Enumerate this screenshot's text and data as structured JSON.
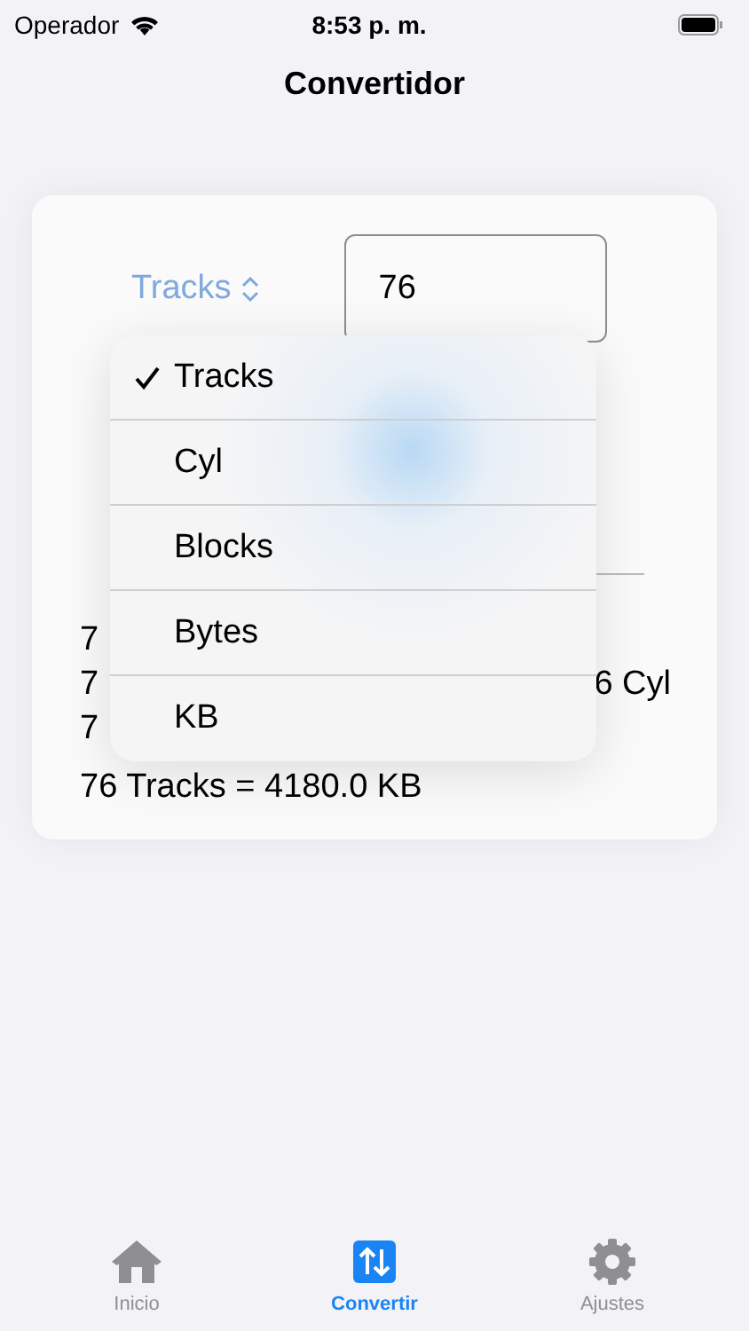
{
  "status_bar": {
    "carrier": "Operador",
    "time": "8:53 p. m."
  },
  "title": "Convertidor",
  "converter": {
    "unit_button": "Tracks",
    "value": "76",
    "results": [
      {
        "text": "7"
      },
      {
        "text": "7",
        "trailing": "6 Cyl"
      },
      {
        "text": "7"
      },
      {
        "text": "76 Tracks = 4180.0 KB"
      }
    ]
  },
  "menu": {
    "items": [
      {
        "label": "Tracks",
        "selected": true
      },
      {
        "label": "Cyl",
        "selected": false
      },
      {
        "label": "Blocks",
        "selected": false
      },
      {
        "label": "Bytes",
        "selected": false
      },
      {
        "label": "KB",
        "selected": false
      }
    ]
  },
  "tab_bar": [
    {
      "label": "Inicio",
      "kind": "home",
      "selected": false
    },
    {
      "label": "Convertir",
      "kind": "convert",
      "selected": true
    },
    {
      "label": "Ajustes",
      "kind": "settings",
      "selected": false
    }
  ]
}
